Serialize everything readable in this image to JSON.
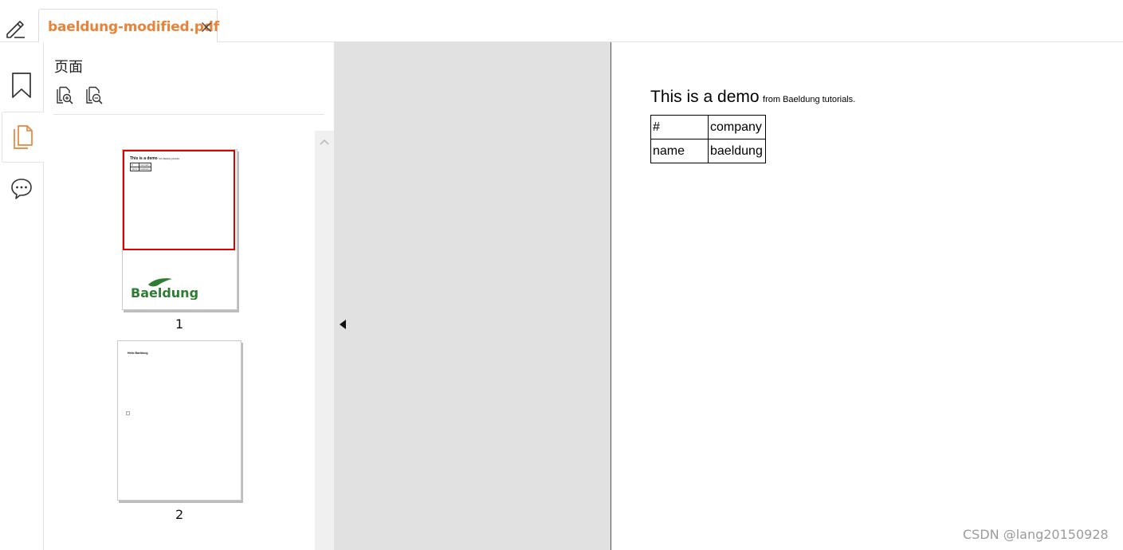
{
  "tab": {
    "title": "baeldung-modified.pdf"
  },
  "icons": {
    "edit": "pencil-icon",
    "close": "close-icon",
    "bookmark": "bookmark-icon",
    "pages": "pages-icon",
    "comments": "comment-icon",
    "zoom_in": "zoom-in-page-icon",
    "zoom_out": "zoom-out-page-icon",
    "scroll_up": "chevron-up-icon",
    "collapse": "triangle-left-icon"
  },
  "colors": {
    "accent": "#e8843a",
    "selection": "#e00000",
    "logo_green": "#2e7d32"
  },
  "sidebar": {
    "title": "页面",
    "pages": [
      {
        "number": "1",
        "mini_title": "This is a demo",
        "mini_sub": "from Baeldung tutorials.",
        "mini_rows": [
          [
            "#",
            "company"
          ],
          [
            "name",
            "baeldung"
          ]
        ],
        "logo": "Baeldung"
      },
      {
        "number": "2",
        "mini_title": "Hello Baeldung"
      }
    ]
  },
  "document": {
    "heading": "This is a demo",
    "subheading": "from Baeldung tutorials.",
    "table": [
      [
        "#",
        "company"
      ],
      [
        "name",
        "baeldung"
      ]
    ]
  },
  "watermark": "CSDN @lang20150928"
}
